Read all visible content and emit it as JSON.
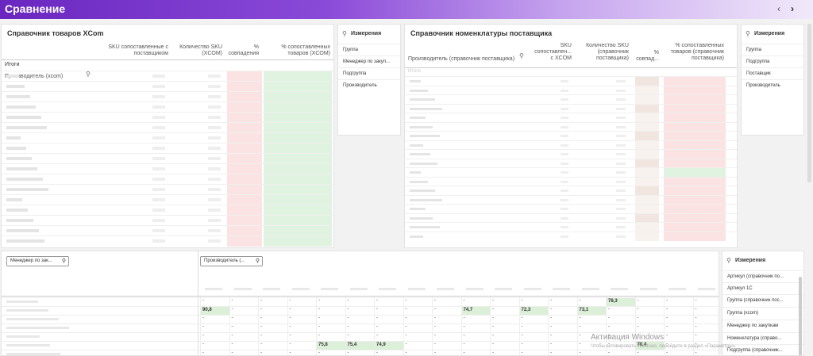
{
  "header": {
    "title": "Сравнение",
    "prev_icon": "chevron-left-icon",
    "next_icon": "chevron-right-icon"
  },
  "xcom": {
    "title": "Справочник товаров XCom",
    "col_producer": "Производитель (xcom)",
    "col_sku_matched": "SKU сопоставленные с поставщиком",
    "col_sku_count": "Количество SKU (XCOM)",
    "col_pct_match": "% совпадения",
    "col_pct_matched": "% сопоставленных товаров (XCOM)",
    "total_label": "Итоги"
  },
  "dims1": {
    "title": "Измерения",
    "items": [
      "Группа",
      "Менеджер по закуп...",
      "Подгруппа",
      "Производитель"
    ]
  },
  "supplier": {
    "title": "Справочник номенклатуры поставщика",
    "col_producer": "Производитель (справочник поставщика)",
    "col_sku_matched": "SKU сопоставлен... с XCOM",
    "col_sku_count": "Количество SKU (справочник поставщика)",
    "col_pct_match": "% совпад...",
    "col_pct_matched": "% сопоставленных товаров (справочник поставщика)",
    "total_label": "Итоги"
  },
  "dims2": {
    "title": "Измерения",
    "items": [
      "Группа",
      "Подгруппа",
      "Поставщик",
      "Производитель"
    ]
  },
  "pivot": {
    "filter_manager": "Менеджер по зак...",
    "filter_producer": "Производитель (...",
    "values": {
      "r0c14": "78,3",
      "r1c0": "90,8",
      "r1c9": "74,7",
      "r1c11": "72,3",
      "r1c13": "73,1",
      "r5c4": "75,8",
      "r5c5": "75,4",
      "r5c6": "74,9",
      "r5c15": "70,4"
    }
  },
  "dims3": {
    "title": "Измерения",
    "items": [
      "Артикул (справочник по...",
      "Артикул 1С",
      "Группа (справочник пос...",
      "Группа (xcom)",
      "Менеджер по закупкам",
      "Номенклатура (справо...",
      "Подгруппа (справочник..."
    ]
  },
  "watermark": {
    "line1": "Активация Windows",
    "line2": "Чтобы активировать Windows, перейдите в раздел «Параметры»."
  }
}
